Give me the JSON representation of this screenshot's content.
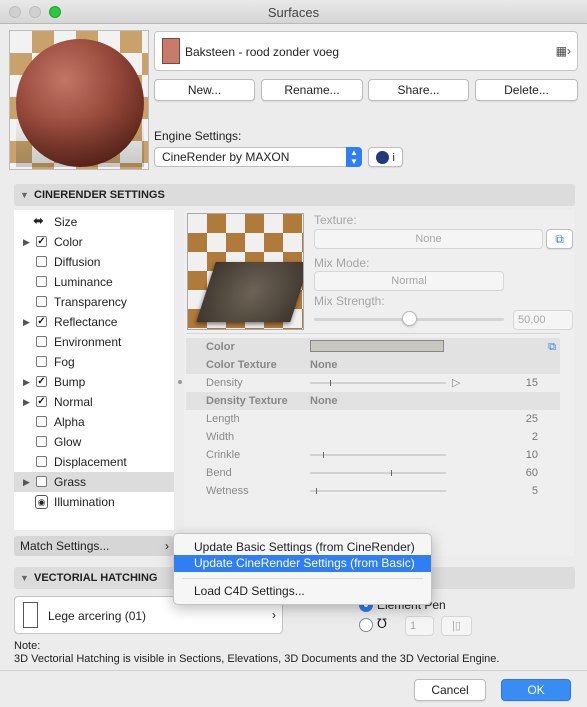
{
  "window": {
    "title": "Surfaces"
  },
  "surface": {
    "name": "Baksteen - rood zonder voeg",
    "swatch_color": "#c87b6b"
  },
  "surface_buttons": {
    "new": "New...",
    "rename": "Rename...",
    "share": "Share...",
    "delete": "Delete..."
  },
  "engine": {
    "label": "Engine Settings:",
    "value": "CineRender by MAXON"
  },
  "cinerender_section": {
    "title": "CINERENDER SETTINGS"
  },
  "channels": [
    {
      "label": "Size",
      "icon": "resize-icon",
      "checked": null,
      "expandable": false
    },
    {
      "label": "Color",
      "checked": true,
      "expandable": true
    },
    {
      "label": "Diffusion",
      "checked": false,
      "expandable": false
    },
    {
      "label": "Luminance",
      "checked": false,
      "expandable": false
    },
    {
      "label": "Transparency",
      "checked": false,
      "expandable": false
    },
    {
      "label": "Reflectance",
      "checked": true,
      "expandable": true
    },
    {
      "label": "Environment",
      "checked": false,
      "expandable": false
    },
    {
      "label": "Fog",
      "checked": false,
      "expandable": false
    },
    {
      "label": "Bump",
      "checked": true,
      "expandable": true
    },
    {
      "label": "Normal",
      "checked": true,
      "expandable": true
    },
    {
      "label": "Alpha",
      "checked": false,
      "expandable": false
    },
    {
      "label": "Glow",
      "checked": false,
      "expandable": false
    },
    {
      "label": "Displacement",
      "checked": false,
      "expandable": false
    },
    {
      "label": "Grass",
      "checked": false,
      "expandable": true,
      "selected": true
    },
    {
      "label": "Illumination",
      "icon": "illumination-icon",
      "checked": null,
      "expandable": false
    }
  ],
  "texture_panel": {
    "texture_label": "Texture:",
    "texture_value": "None",
    "mix_mode_label": "Mix Mode:",
    "mix_mode_value": "Normal",
    "mix_strength_label": "Mix Strength:",
    "mix_strength_value": "50,00",
    "mix_strength_level": 0.5
  },
  "grass_props": {
    "color_label": "Color",
    "color_value": "#c8c8c0",
    "color_texture_label": "Color Texture",
    "color_texture_value": "None",
    "density_label": "Density",
    "density_value": "15",
    "density_texture_label": "Density Texture",
    "density_texture_value": "None",
    "length_label": "Length",
    "length_value": "25",
    "width_label": "Width",
    "width_value": "2",
    "crinkle_label": "Crinkle",
    "crinkle_value": "10",
    "bend_label": "Bend",
    "bend_value": "60",
    "wetness_label": "Wetness",
    "wetness_value": "5"
  },
  "match_settings": {
    "label": "Match Settings..."
  },
  "match_menu": {
    "item1": "Update Basic Settings (from CineRender)",
    "item2": "Update CineRender Settings (from Basic)",
    "item3": "Load C4D Settings..."
  },
  "hatching_section": {
    "title": "VECTORIAL HATCHING"
  },
  "hatching": {
    "name": "Lege arcering (01)",
    "pen_option": "Element Pen",
    "pen_number": "1"
  },
  "note": {
    "label": "Note:",
    "text": "3D Vectorial Hatching is visible in Sections, Elevations, 3D Documents and the 3D Vectorial Engine."
  },
  "dialog_buttons": {
    "cancel": "Cancel",
    "ok": "OK"
  },
  "colors": {
    "accent": "#2f7ef3",
    "brick": "#9c4e3f"
  }
}
